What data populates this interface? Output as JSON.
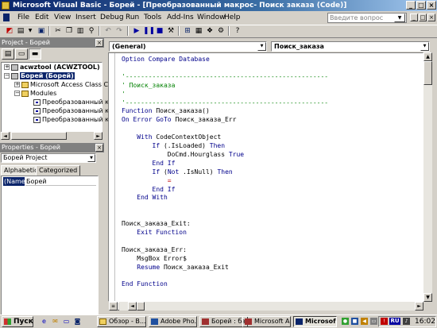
{
  "window": {
    "title": "Microsoft Visual Basic - Борей - [Преобразованный макрос- Поиск заказа (Code)]",
    "controls": [
      "_",
      "□",
      "×"
    ]
  },
  "menu": {
    "items": [
      "File",
      "Edit",
      "View",
      "Insert",
      "Debug",
      "Run",
      "Tools",
      "Add-Ins",
      "Window",
      "Help"
    ],
    "help_placeholder": "Введите вопрос",
    "mdi_controls": [
      "_",
      "□",
      "×"
    ]
  },
  "project_panel": {
    "title": "Project - Борей",
    "close": "×",
    "tree": [
      {
        "label": "acwztool (ACWZTOOL)",
        "expander": "+"
      },
      {
        "label": "Борей (Борей)",
        "expander": "−"
      },
      {
        "label": "Microsoft Access Class C",
        "expander": "+"
      },
      {
        "label": "Modules",
        "expander": "−"
      },
      {
        "label": "Преобразованный к"
      },
      {
        "label": "Преобразованный к"
      },
      {
        "label": "Преобразованный к"
      }
    ]
  },
  "properties_panel": {
    "title": "Properties - Борей",
    "close": "×",
    "object_combo": "Борей Project",
    "tabs": [
      "Alphabetic",
      "Categorized"
    ],
    "rows": [
      {
        "name": "(Name)",
        "value": "Борей"
      }
    ]
  },
  "code_window": {
    "object_combo": "(General)",
    "procedure_combo": "Поиск_заказа",
    "lines": [
      {
        "segments": [
          {
            "t": "Option Compare Database",
            "c": "kw"
          }
        ]
      },
      {
        "segments": []
      },
      {
        "segments": [
          {
            "t": "'-----------------------------------------------------",
            "c": "cm"
          }
        ]
      },
      {
        "segments": [
          {
            "t": "' Поиск_заказа",
            "c": "cm"
          }
        ]
      },
      {
        "segments": [
          {
            "t": "'",
            "c": "cm"
          }
        ]
      },
      {
        "segments": [
          {
            "t": "'-----------------------------------------------------",
            "c": "cm"
          }
        ]
      },
      {
        "segments": [
          {
            "t": "Function ",
            "c": "kw"
          },
          {
            "t": "Поиск_заказа()",
            "c": ""
          }
        ]
      },
      {
        "segments": [
          {
            "t": "On Error GoTo ",
            "c": "kw"
          },
          {
            "t": "Поиск_заказа_Err",
            "c": ""
          }
        ]
      },
      {
        "segments": []
      },
      {
        "segments": [
          {
            "t": "    With ",
            "c": "kw"
          },
          {
            "t": "CodeContextObject",
            "c": ""
          }
        ]
      },
      {
        "segments": [
          {
            "t": "        If ",
            "c": "kw"
          },
          {
            "t": "(.IsLoaded) ",
            "c": ""
          },
          {
            "t": "Then",
            "c": "kw"
          }
        ]
      },
      {
        "segments": [
          {
            "t": "            DoCmd.Hourglass ",
            "c": ""
          },
          {
            "t": "True",
            "c": "kw"
          }
        ]
      },
      {
        "segments": [
          {
            "t": "        End If",
            "c": "kw"
          }
        ]
      },
      {
        "segments": [
          {
            "t": "        If ",
            "c": "kw"
          },
          {
            "t": "(",
            "c": ""
          },
          {
            "t": "Not ",
            "c": "kw"
          },
          {
            "t": ".IsNull) ",
            "c": ""
          },
          {
            "t": "Then",
            "c": "kw"
          }
        ]
      },
      {
        "segments": [
          {
            "t": "            =",
            "c": "cr"
          }
        ]
      },
      {
        "segments": [
          {
            "t": "        End If",
            "c": "kw"
          }
        ]
      },
      {
        "segments": [
          {
            "t": "    End With",
            "c": "kw"
          }
        ]
      },
      {
        "segments": []
      },
      {
        "segments": []
      },
      {
        "segments": [
          {
            "t": "Поиск_заказа_Exit:",
            "c": ""
          }
        ]
      },
      {
        "segments": [
          {
            "t": "    Exit Function",
            "c": "kw"
          }
        ]
      },
      {
        "segments": []
      },
      {
        "segments": [
          {
            "t": "Поиск_заказа_Err:",
            "c": ""
          }
        ]
      },
      {
        "segments": [
          {
            "t": "    MsgBox ",
            "c": ""
          },
          {
            "t": "Error$",
            "c": ""
          }
        ]
      },
      {
        "segments": [
          {
            "t": "    Resume ",
            "c": "kw"
          },
          {
            "t": "Поиск_заказа_Exit",
            "c": ""
          }
        ]
      },
      {
        "segments": []
      },
      {
        "segments": [
          {
            "t": "End Function",
            "c": "kw"
          }
        ]
      }
    ]
  },
  "taskbar": {
    "start": "Пуск",
    "tasks": [
      {
        "label": "Обзор - B...",
        "active": false
      },
      {
        "label": "Adobe Pho...",
        "active": false
      },
      {
        "label": "Борей : ба...",
        "active": false
      },
      {
        "label": "Microsoft A...",
        "active": false
      },
      {
        "label": "Microsof...",
        "active": true
      }
    ],
    "tray_lang": "RU",
    "clock": "16:02"
  },
  "colors": {
    "titlebar": "#0a246a",
    "keyword": "#00008b",
    "comment": "#008000",
    "error": "#c00000",
    "chrome": "#d4d0c8"
  }
}
